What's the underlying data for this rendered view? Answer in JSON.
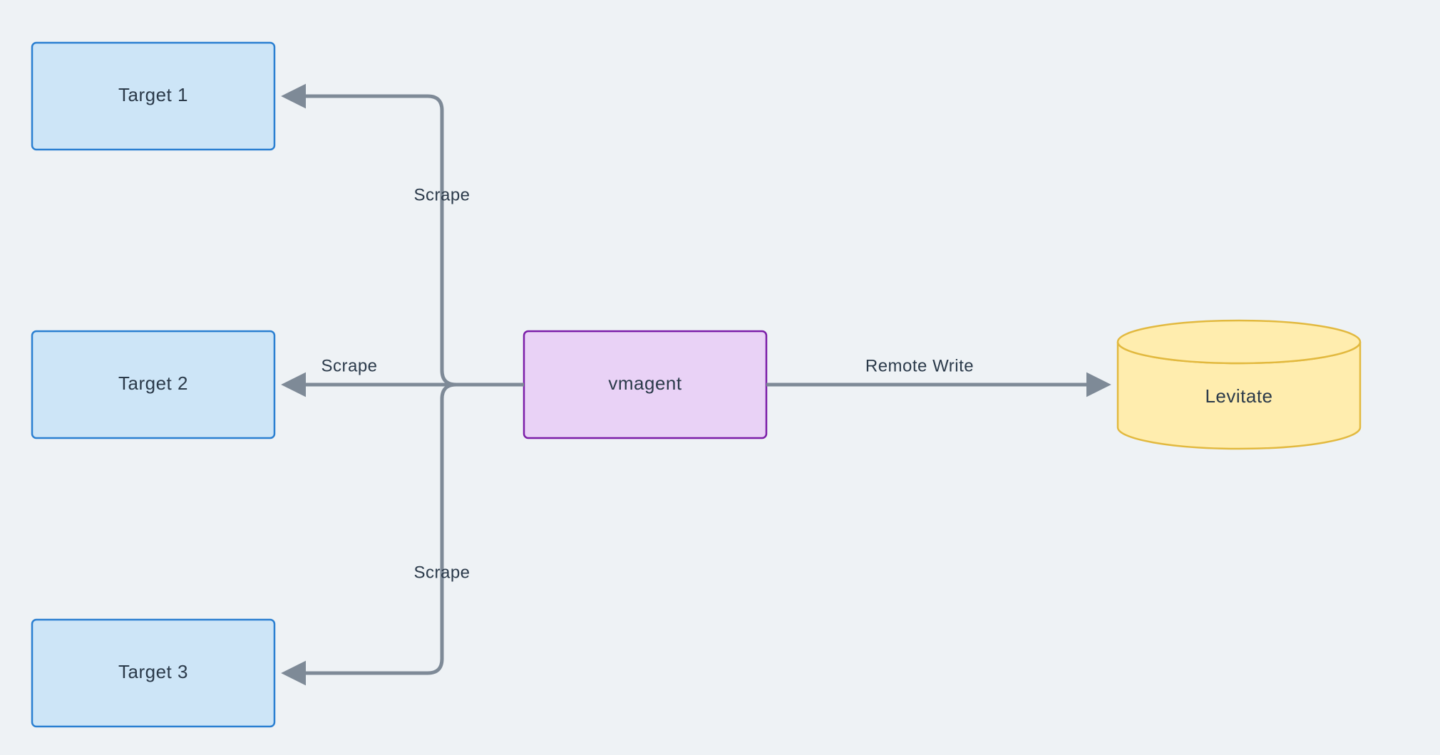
{
  "nodes": {
    "target1": "Target 1",
    "target2": "Target 2",
    "target3": "Target 3",
    "agent": "vmagent",
    "store": "Levitate"
  },
  "edges": {
    "scrape1": "Scrape",
    "scrape2": "Scrape",
    "scrape3": "Scrape",
    "remoteWrite": "Remote Write"
  },
  "colors": {
    "background": "#eef2f5",
    "targetFill": "#cde5f7",
    "targetStroke": "#2a7fd1",
    "agentFill": "#e9d2f6",
    "agentStroke": "#7b1da8",
    "storeFill": "#ffedae",
    "storeStroke": "#e2b93f",
    "edge": "#7e8a97",
    "text": "#2b3a4a"
  }
}
